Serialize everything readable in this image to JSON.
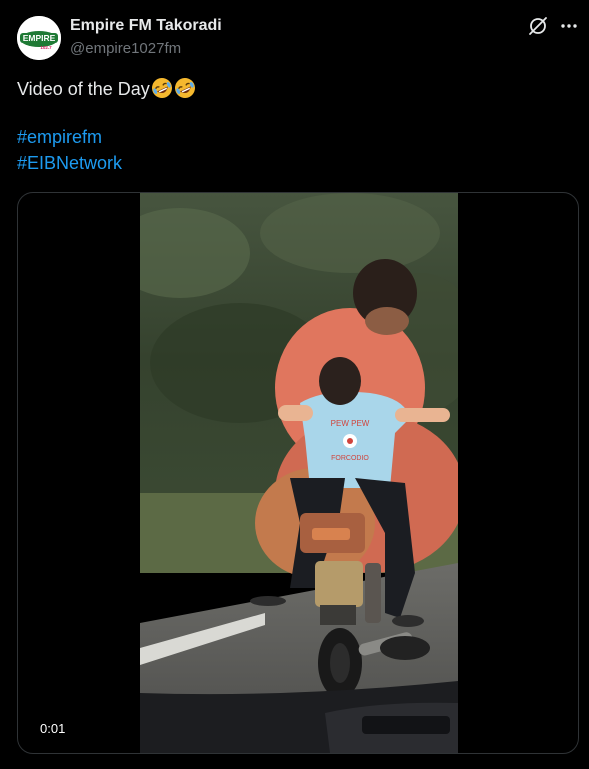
{
  "author": {
    "display_name": "Empire FM Takoradi",
    "handle": "@empire1027fm",
    "avatar_text": "EMPIRE",
    "avatar_subtext": "102.7"
  },
  "tweet": {
    "text": "Video of the Day",
    "emojis": [
      "rolling-on-floor-laughing",
      "rolling-on-floor-laughing"
    ],
    "hashtags": [
      "#empirefm",
      "#EIBNetwork"
    ]
  },
  "media": {
    "type": "video",
    "timestamp": "0:01",
    "shirt_text_top": "PEW PEW",
    "shirt_text_bottom": "FORCODIO"
  },
  "icons": {
    "grok": "grok-icon",
    "more": "more-dots-icon"
  },
  "colors": {
    "background": "#000000",
    "text": "#e7e9ea",
    "secondary": "#71767b",
    "link": "#1d9bf0",
    "border": "#2f3336"
  }
}
